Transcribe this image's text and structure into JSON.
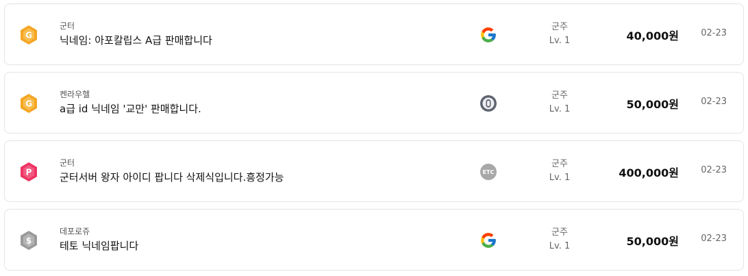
{
  "listings": [
    {
      "badge": "gold-g-badge-icon",
      "server": "군터",
      "title": "닉네임: 아포칼립스 A급 판매합니다",
      "platform": "google-icon",
      "job": "군주",
      "level": "Lv. 1",
      "price": "40,000원",
      "date": "02-23"
    },
    {
      "badge": "gold-g-badge-icon",
      "server": "켄라우헬",
      "title": "a급 id 닉네임 '교만' 판매합니다.",
      "platform": "account-circle-icon",
      "job": "군주",
      "level": "Lv. 1",
      "price": "50,000원",
      "date": "02-23"
    },
    {
      "badge": "pink-p-badge-icon",
      "server": "군터",
      "title": "군터서버 왕자 아이디 팝니다 삭제식입니다.흥정가능",
      "platform": "etc-icon",
      "platform_label": "ETC",
      "job": "군주",
      "level": "Lv. 1",
      "price": "400,000원",
      "date": "02-23"
    },
    {
      "badge": "gray-dollar-badge-icon",
      "server": "데포로쥬",
      "title": "테토 닉네임팝니다",
      "platform": "google-icon",
      "job": "군주",
      "level": "Lv. 1",
      "price": "50,000원",
      "date": "02-23"
    }
  ],
  "colors": {
    "gold_badge": "#f5a623",
    "pink_badge": "#ee3463",
    "gray_badge": "#9a9a9a",
    "etc_badge": "#a8a8a8",
    "card_border": "#e2e4e8"
  }
}
